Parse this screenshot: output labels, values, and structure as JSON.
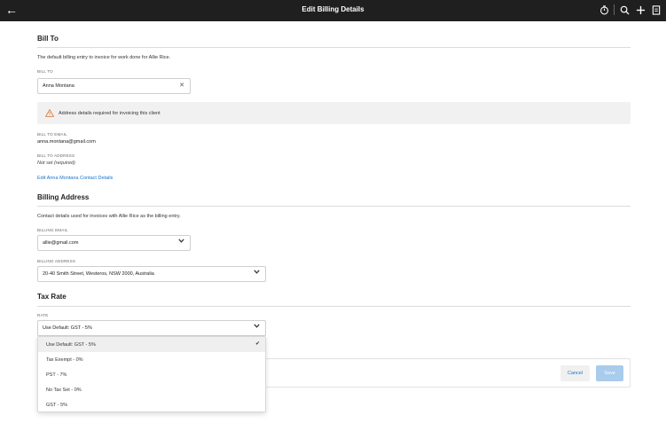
{
  "header": {
    "title": "Edit Billing Details",
    "back_icon": "arrow-left-icon",
    "icons": [
      "timer-icon",
      "search-icon",
      "plus-icon",
      "document-icon"
    ]
  },
  "bill_to": {
    "section_title": "Bill To",
    "description": "The default billing entry to invoice for work done for Allie Rice.",
    "field_label": "BILL TO",
    "field_value": "Anna Montana",
    "alert_text": "Address details required for invoicing this client",
    "email_label": "BILL TO EMAIL",
    "email_value": "anna.montana@gmail.com",
    "address_label": "BILL TO ADDRESS",
    "address_value": "Not set (required)",
    "edit_link": "Edit Anna Montana Contact Details"
  },
  "billing_address": {
    "section_title": "Billing Address",
    "description": "Contact details used for invoices with Allie Rice as the billing entry.",
    "email_label": "BILLING EMAIL",
    "email_value": "allie@gmail.com",
    "address_label": "BILLING ADDRESS",
    "address_value": "20-40 Smith Street, Westeros, NSW 2000, Australia"
  },
  "tax_rate": {
    "section_title": "Tax Rate",
    "rate_label": "RATE",
    "rate_value": "Use Default: GST - 5%",
    "options": [
      {
        "label": "Use Default: GST - 5%",
        "selected": true
      },
      {
        "label": "Tax Exempt - 0%",
        "selected": false
      },
      {
        "label": "PST - 7%",
        "selected": false
      },
      {
        "label": "No Tax Set - 0%",
        "selected": false
      },
      {
        "label": "GST - 5%",
        "selected": false
      }
    ]
  },
  "actions": {
    "cancel_label": "Cancel",
    "save_label": "Save"
  },
  "colors": {
    "topbar": "#1f1f1f",
    "link": "#1a73c8",
    "save_disabled": "#a9cbec",
    "warning": "#e07a3a"
  }
}
